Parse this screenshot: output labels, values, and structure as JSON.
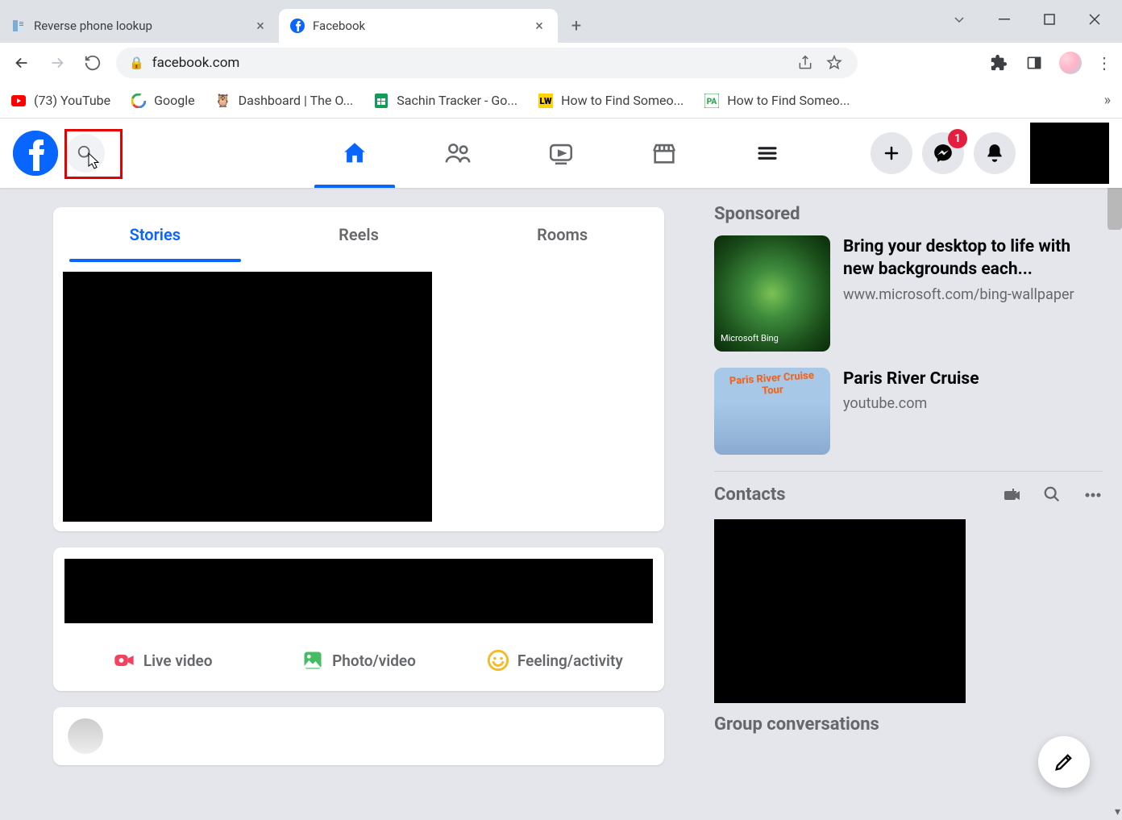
{
  "browser": {
    "tabs": [
      {
        "title": "Reverse phone lookup"
      },
      {
        "title": "Facebook"
      }
    ],
    "url": "facebook.com",
    "bookmarks": [
      {
        "label": "(73) YouTube",
        "icon": "youtube"
      },
      {
        "label": "Google",
        "icon": "google"
      },
      {
        "label": "Dashboard | The O...",
        "icon": "owl"
      },
      {
        "label": "Sachin Tracker - Go...",
        "icon": "sheets"
      },
      {
        "label": "How to Find Someo...",
        "icon": "lw"
      },
      {
        "label": "How to Find Someo...",
        "icon": "pa"
      }
    ]
  },
  "fb": {
    "messenger_badge": "1",
    "tabs": {
      "stories": "Stories",
      "reels": "Reels",
      "rooms": "Rooms"
    },
    "composer": {
      "live": "Live video",
      "photo": "Photo/video",
      "feeling": "Feeling/activity"
    },
    "sponsored": {
      "heading": "Sponsored",
      "items": [
        {
          "title": "Bring your desktop to life with new backgrounds each...",
          "domain": "www.microsoft.com/bing-wallpaper",
          "bing": "Microsoft Bing"
        },
        {
          "title": "Paris River Cruise",
          "domain": "youtube.com",
          "overlay": "Paris River Cruise Tour"
        }
      ]
    },
    "contacts_heading": "Contacts",
    "group_heading": "Group conversations"
  }
}
